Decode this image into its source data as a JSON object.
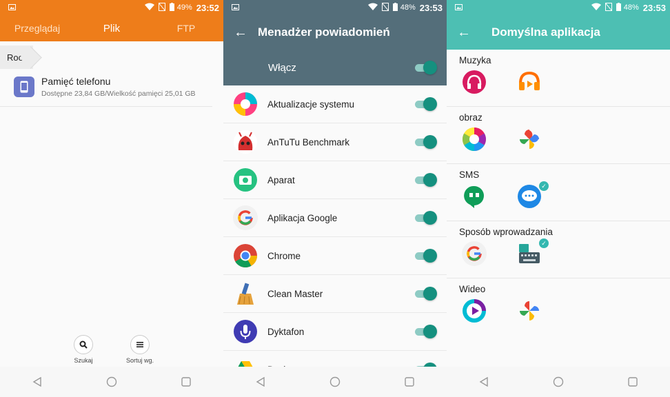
{
  "panel1": {
    "status": {
      "battery": "49%",
      "time": "23:52"
    },
    "tabs": [
      "Przeglądaj",
      "Plik",
      "FTP"
    ],
    "breadcrumb": "Root",
    "storage": {
      "name": "Pamięć telefonu",
      "details": "Dostępne 23,84 GB/Wielkość pamięci 25,01 GB"
    },
    "actions": {
      "search": "Szukaj",
      "sort": "Sortuj wg."
    }
  },
  "panel2": {
    "status": {
      "battery": "48%",
      "time": "23:53"
    },
    "title": "Menadżer powiadomień",
    "enable_label": "Włącz",
    "apps": [
      {
        "name": "Aktualizacje systemu",
        "icon": "system-update-icon"
      },
      {
        "name": "AnTuTu Benchmark",
        "icon": "antutu-icon"
      },
      {
        "name": "Aparat",
        "icon": "camera-icon"
      },
      {
        "name": "Aplikacja Google",
        "icon": "google-icon"
      },
      {
        "name": "Chrome",
        "icon": "chrome-icon"
      },
      {
        "name": "Clean Master",
        "icon": "clean-master-icon"
      },
      {
        "name": "Dyktafon",
        "icon": "dictaphone-icon"
      },
      {
        "name": "Dysk",
        "icon": "drive-icon"
      }
    ]
  },
  "panel3": {
    "status": {
      "battery": "48%",
      "time": "23:53"
    },
    "title": "Domyślna aplikacja",
    "sections": [
      {
        "title": "Muzyka",
        "icons": [
          "music-player-icon",
          "play-music-icon"
        ]
      },
      {
        "title": "obraz",
        "icons": [
          "gallery-icon",
          "google-photos-icon"
        ]
      },
      {
        "title": "SMS",
        "icons": [
          "hangouts-icon",
          "messages-icon"
        ]
      },
      {
        "title": "Sposób wprowadzania",
        "icons": [
          "google-keyboard-icon",
          "keyboard-icon"
        ]
      },
      {
        "title": "Wideo",
        "icons": [
          "video-player-icon",
          "google-photos-icon"
        ]
      }
    ]
  }
}
